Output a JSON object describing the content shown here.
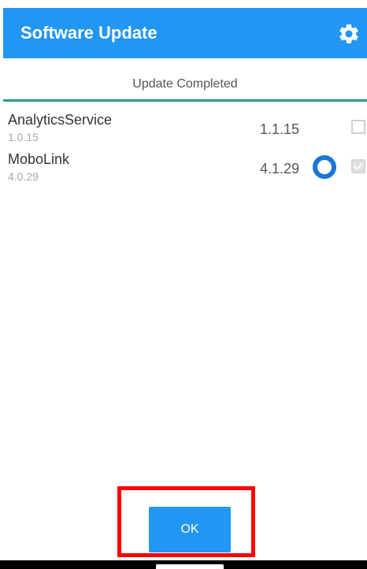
{
  "app_bar": {
    "title": "Software Update",
    "icon": "gear-icon",
    "color": "#2196f3"
  },
  "status": {
    "text": "Update Completed",
    "line_color": "#1f9e8c"
  },
  "packages": [
    {
      "name": "AnalyticsService",
      "installed_version": "1.0.15",
      "latest_version": "1.1.15",
      "checked": false,
      "in_progress": false
    },
    {
      "name": "MoboLink",
      "installed_version": "4.0.29",
      "latest_version": "4.1.29",
      "checked": true,
      "in_progress": true
    }
  ],
  "ok_button": {
    "label": "OK"
  },
  "highlight_color": "#ff0000"
}
